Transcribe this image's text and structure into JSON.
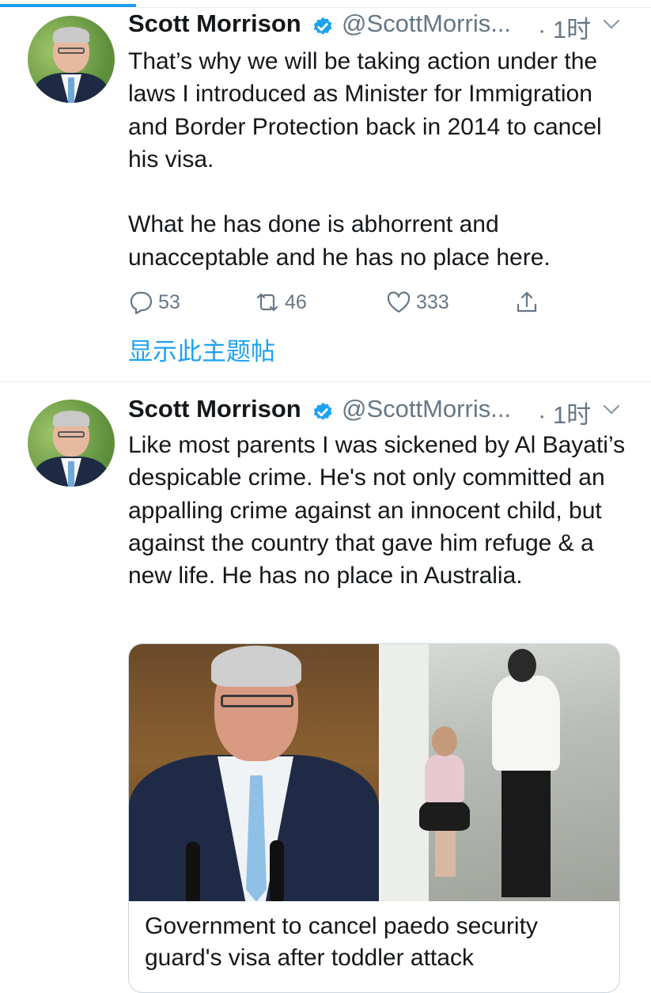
{
  "tweets": [
    {
      "author_name": "Scott Morrison",
      "handle": "@ScottMorris...",
      "time": "· 1时",
      "text": "That’s why we will be taking action under the laws I introduced as Minister for Immigration and Border Protection back in 2014 to cancel his visa.\n\nWhat he has done is abhorrent and unacceptable and he has no place here.",
      "replies": "53",
      "retweets": "46",
      "likes": "333",
      "show_thread": "显示此主题帖"
    },
    {
      "author_name": "Scott Morrison",
      "handle": "@ScottMorris...",
      "time": "· 1时",
      "text": "Like most parents I was sickened by Al Bayati’s despicable crime. He's not only committed an appalling crime against an innocent child, but against the country that gave him refuge & a new life. He has no place in Australia.",
      "card_title": "Government to cancel paedo security guard's visa after toddler attack"
    }
  ],
  "icons": {
    "verified": "verified-badge-icon",
    "caret": "chevron-down-icon",
    "reply": "reply-icon",
    "retweet": "retweet-icon",
    "like": "heart-icon",
    "share": "share-icon"
  },
  "colors": {
    "accent": "#1da1f2",
    "text": "#14171a",
    "secondary": "#657786",
    "divider": "#e6ecf0"
  }
}
